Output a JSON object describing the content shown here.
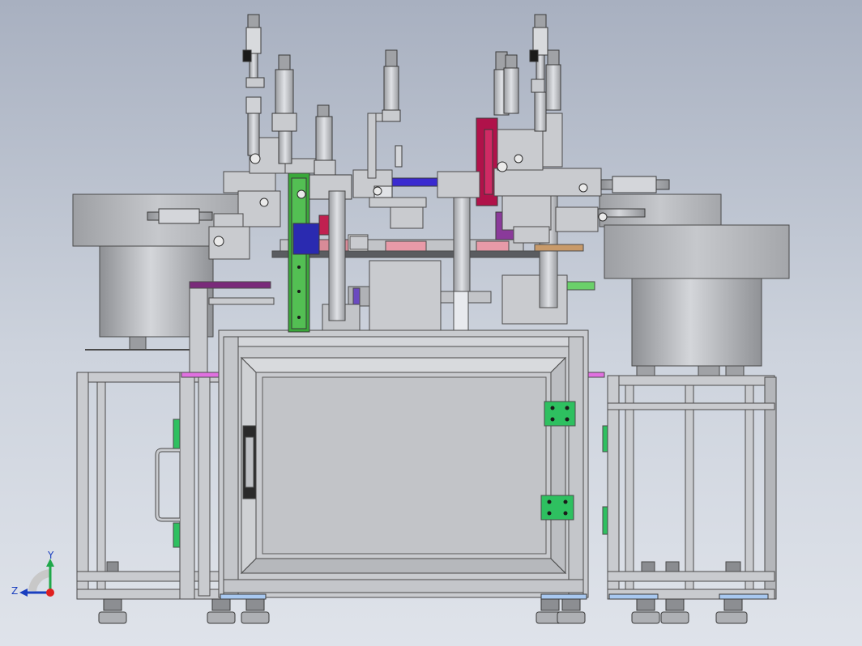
{
  "viewport": {
    "background_top": "#a8b0c0",
    "background_bottom": "#dfe3ea"
  },
  "triad": {
    "y_label": "Y",
    "z_label": "Z",
    "y_axis_color": "#1fa84a",
    "z_axis_color": "#1a3fbf",
    "origin_color": "#e02020"
  },
  "accent_colors": {
    "frame_gray": "#c9cbcf",
    "panel_gray": "#c2c4c8",
    "green_plate": "#3aa83a",
    "bracket_green": "#2ec060",
    "crimson_block": "#b0124a",
    "purple_rail": "#7a2a7a",
    "blue_part": "#2a2ab0",
    "pink_pad": "#e89aa8",
    "foot_blue": "#a8c8f0",
    "magenta_strip": "#e070e0"
  }
}
